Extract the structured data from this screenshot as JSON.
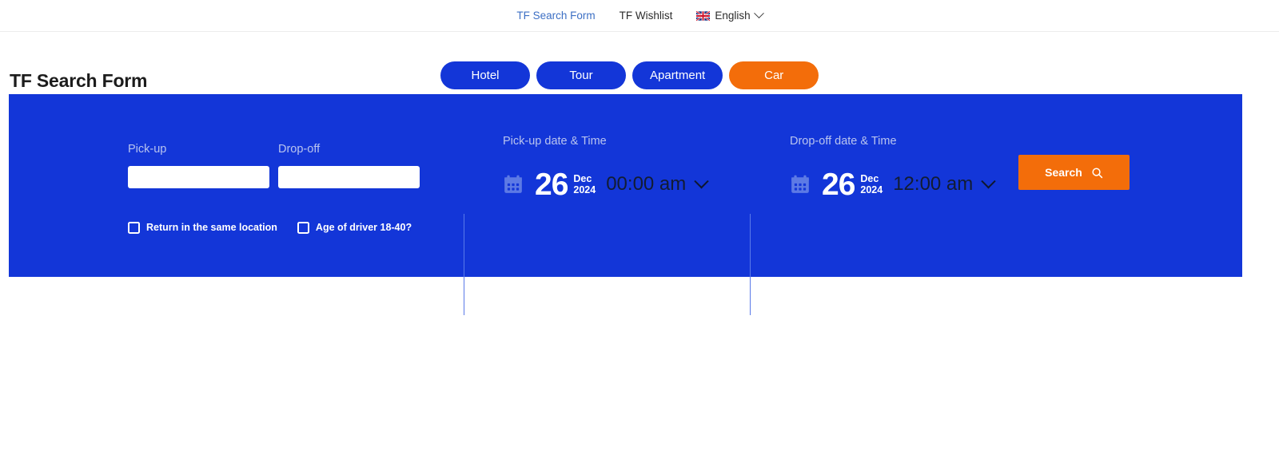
{
  "topbar": {
    "links": [
      {
        "label": "TF Search Form",
        "active": true
      },
      {
        "label": "TF Wishlist",
        "active": false
      }
    ],
    "language": {
      "label": "English",
      "flag_icon": "uk-flag-icon",
      "chevron_icon": "chevron-down-icon"
    }
  },
  "page": {
    "title": "TF Search Form"
  },
  "tabs": [
    {
      "label": "Hotel",
      "active": false
    },
    {
      "label": "Tour",
      "active": false
    },
    {
      "label": "Apartment",
      "active": false
    },
    {
      "label": "Car",
      "active": true
    }
  ],
  "form": {
    "pickup_location": {
      "label": "Pick-up",
      "value": "",
      "placeholder": ""
    },
    "dropoff_location": {
      "label": "Drop-off",
      "value": "",
      "placeholder": ""
    },
    "checkboxes": [
      {
        "label": "Return in the same location",
        "checked": false
      },
      {
        "label": "Age of driver 18-40?",
        "checked": false
      }
    ],
    "pickup_datetime": {
      "label": "Pick-up date & Time",
      "calendar_icon": "calendar-icon",
      "day": "26",
      "month": "Dec",
      "year": "2024",
      "time": "00:00 am",
      "chevron_icon": "chevron-down-icon"
    },
    "dropoff_datetime": {
      "label": "Drop-off date & Time",
      "calendar_icon": "calendar-icon",
      "day": "26",
      "month": "Dec",
      "year": "2024",
      "time": "12:00 am",
      "chevron_icon": "chevron-down-icon"
    },
    "search_button": {
      "label": "Search",
      "icon": "search-icon"
    }
  },
  "colors": {
    "panel_blue": "#1336d8",
    "accent_orange": "#f36d0a",
    "label_muted": "#b9c4ef",
    "link_blue": "#3c6fc4",
    "divider": "#5a7ae8"
  }
}
